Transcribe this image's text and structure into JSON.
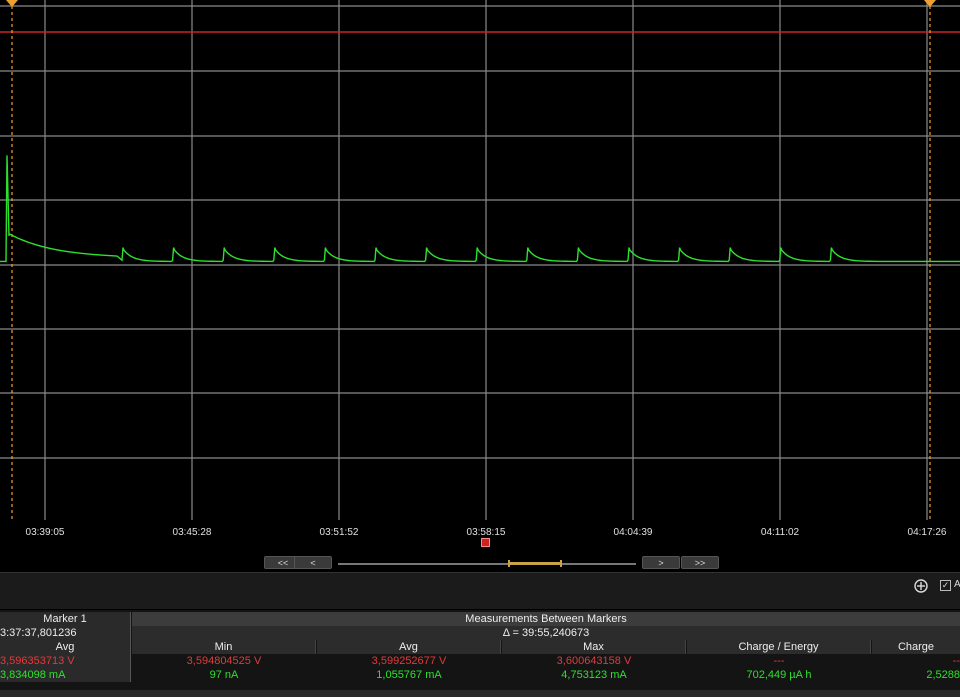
{
  "chart_data": {
    "type": "line",
    "x_ticks": [
      "03:39:05",
      "03:45:28",
      "03:51:52",
      "03:58:15",
      "04:04:39",
      "04:11:02",
      "04:17:26"
    ],
    "series": [
      {
        "color": "#2ee02e",
        "baseline": 0.055,
        "pulse_peak": 0.27,
        "pulses": 15,
        "initial_spike": 1.7
      }
    ],
    "threshold_line_color": "#cc2222",
    "marker_color": "#f0a030",
    "grid": true
  },
  "navigation": {
    "first_label": "<<",
    "prev_label": "<",
    "next_label": ">",
    "last_label": ">>",
    "scroll_position": 0.62
  },
  "toolbar": {
    "zoom_icon": "zoom-in-icon",
    "auto_check": "✓",
    "auto_label": "A"
  },
  "table": {
    "marker_header": "Marker 1",
    "marker_time": "3:37:37,801236",
    "measure_header": "Measurements Between Markers",
    "delta": "Δ = 39:55,240673",
    "columns": {
      "avg_left": "Avg",
      "min": "Min",
      "avg": "Avg",
      "max": "Max",
      "charge_energy": "Charge / Energy",
      "charge": "Charge"
    },
    "voltage_row": {
      "marker": "3,596353713 V",
      "min": "3,594804525 V",
      "avg": "3,599252677 V",
      "max": "3,600643158 V",
      "charge_energy": "---",
      "charge": "--"
    },
    "current_row": {
      "marker": "3,834098 mA",
      "min": "97 nA",
      "avg": "1,055767 mA",
      "max": "4,753123 mA",
      "charge_energy": "702,449 µA h",
      "charge": "2,5288"
    }
  }
}
